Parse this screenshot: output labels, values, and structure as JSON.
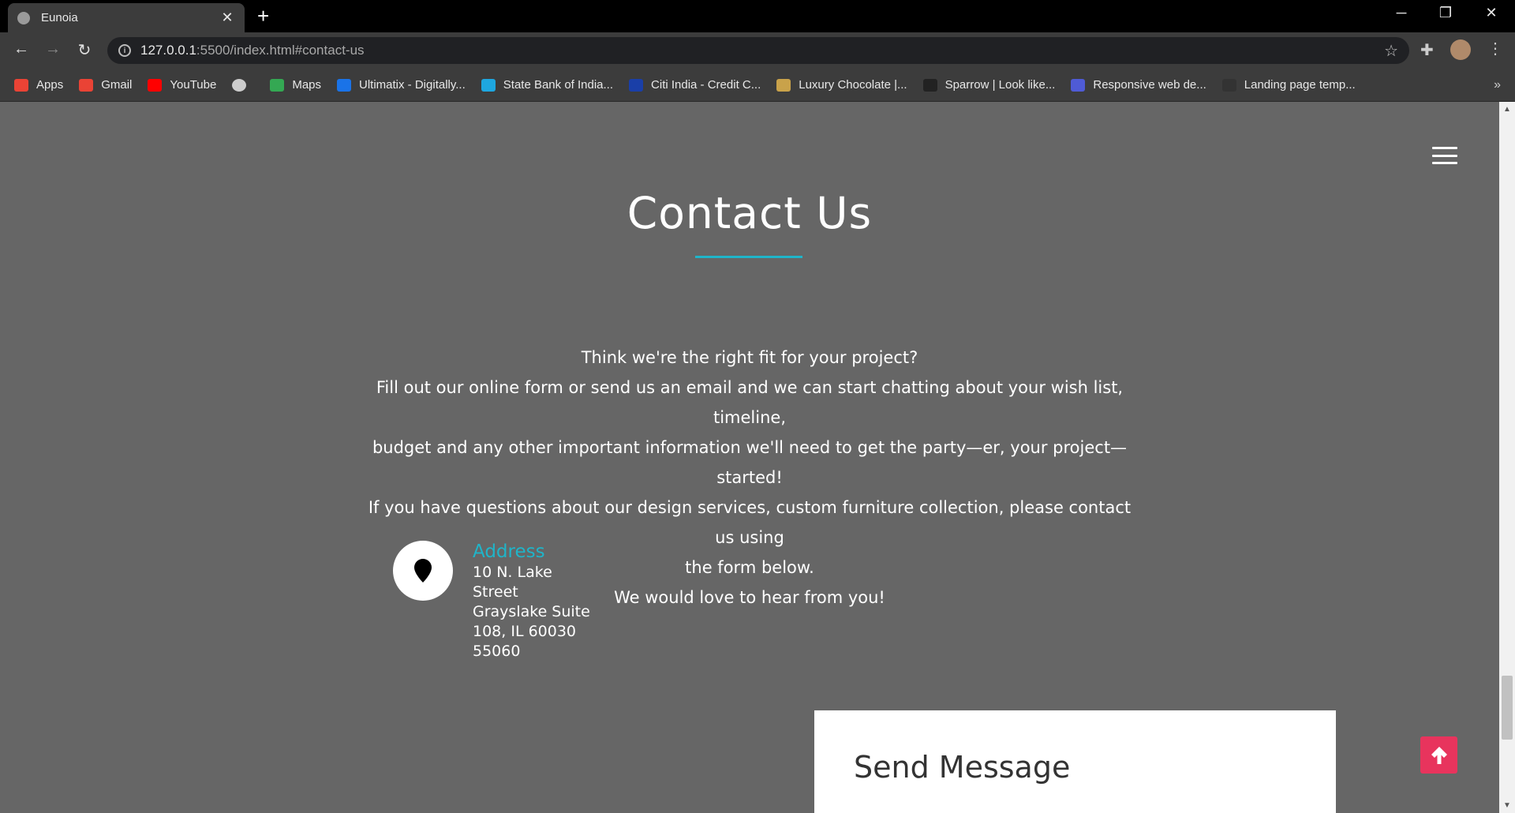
{
  "browser": {
    "tab_title": "Eunoia",
    "url_host": "127.0.0.1",
    "url_rest": ":5500/index.html#contact-us",
    "bookmarks": [
      {
        "label": "Apps",
        "color": "#ea4335"
      },
      {
        "label": "Gmail",
        "color": "#ea4335"
      },
      {
        "label": "YouTube",
        "color": "#ff0000"
      },
      {
        "label": "",
        "color": "#cccccc"
      },
      {
        "label": "Maps",
        "color": "#34a853"
      },
      {
        "label": "Ultimatix - Digitally...",
        "color": "#1a73e8"
      },
      {
        "label": "State Bank of India...",
        "color": "#1ea7e0"
      },
      {
        "label": "Citi India - Credit C...",
        "color": "#1a3fa8"
      },
      {
        "label": "Luxury Chocolate |...",
        "color": "#c9a24a"
      },
      {
        "label": "Sparrow | Look like...",
        "color": "#222222"
      },
      {
        "label": "Responsive web de...",
        "color": "#4f5bd5"
      },
      {
        "label": "Landing page temp...",
        "color": "#333333"
      }
    ]
  },
  "contact": {
    "title": "Contact Us",
    "intro_lines": [
      "Think we're the right fit for your project?",
      "Fill out our online form or send us an email and we can start chatting about your wish list, timeline,",
      "budget and any other important information we'll need to get the party—er, your project—started!",
      "If you have questions about our design services, custom furniture collection, please contact us using",
      "the form below.",
      "We would love to hear from you!"
    ],
    "address_label": "Address",
    "address_lines": [
      "10 N. Lake",
      "Street",
      "Grayslake Suite",
      "108, IL 60030",
      "55060"
    ],
    "send_message_title": "Send Message"
  },
  "colors": {
    "accent": "#1fb5c9",
    "back_to_top": "#e8345d",
    "background": "#666666"
  }
}
